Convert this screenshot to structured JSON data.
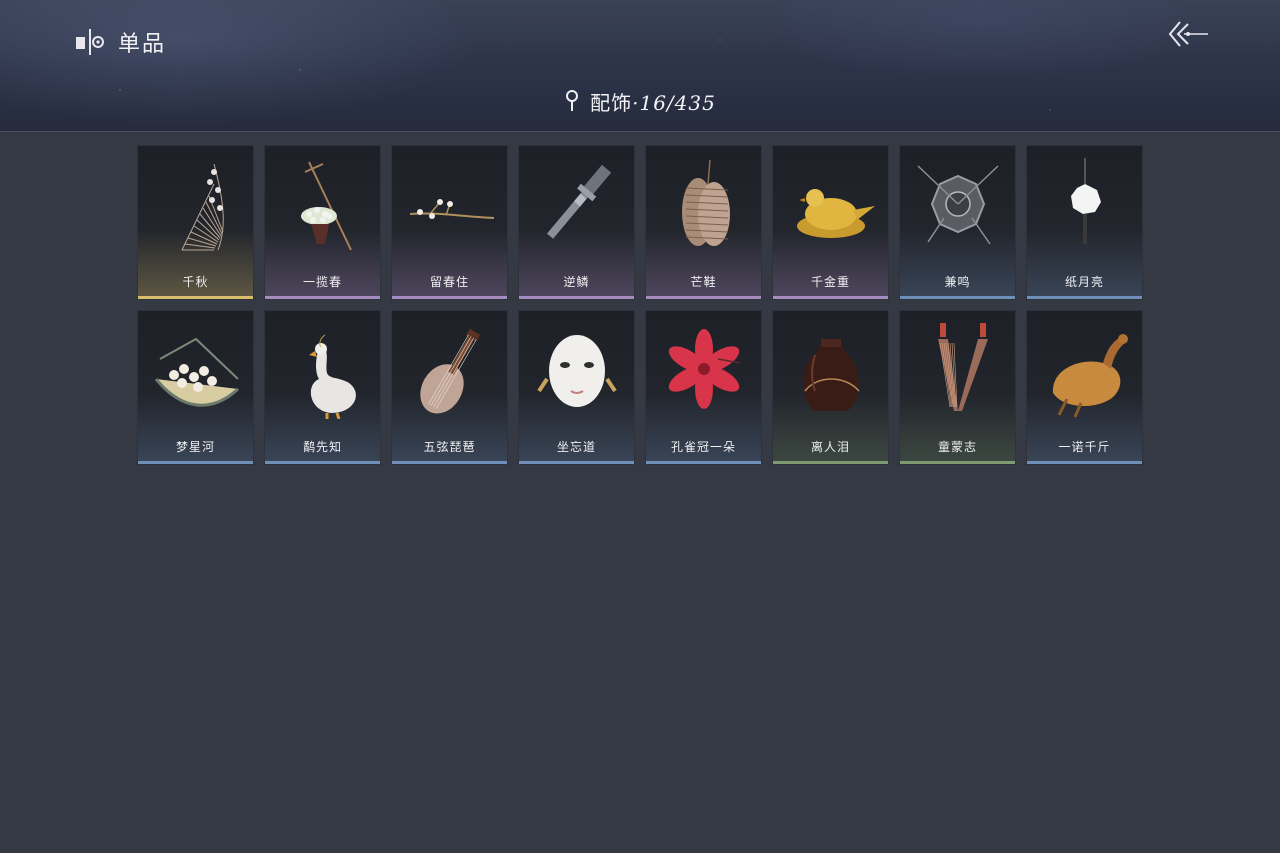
{
  "header": {
    "title": "单品",
    "category_name": "配饰",
    "category_separator": "·",
    "category_count": "16/435"
  },
  "items": [
    {
      "label": "千秋",
      "icon": "swing-flower-icon",
      "quality": "gold"
    },
    {
      "label": "一揽春",
      "icon": "flower-basket-icon",
      "quality": "purple"
    },
    {
      "label": "留春住",
      "icon": "blossom-branch-icon",
      "quality": "purple"
    },
    {
      "label": "逆鳞",
      "icon": "scabbard-icon",
      "quality": "purple"
    },
    {
      "label": "芒鞋",
      "icon": "straw-sandals-icon",
      "quality": "purple"
    },
    {
      "label": "千金重",
      "icon": "golden-bird-icon",
      "quality": "purple"
    },
    {
      "label": "兼鸣",
      "icon": "mirror-pendant-icon",
      "quality": "blue"
    },
    {
      "label": "纸月亮",
      "icon": "paper-moon-icon",
      "quality": "blue"
    },
    {
      "label": "梦星河",
      "icon": "flower-boat-icon",
      "quality": "blue"
    },
    {
      "label": "鹬先知",
      "icon": "duck-icon",
      "quality": "blue"
    },
    {
      "label": "五弦琵琶",
      "icon": "pipa-lute-icon",
      "quality": "blue"
    },
    {
      "label": "坐忘道",
      "icon": "white-mask-icon",
      "quality": "blue"
    },
    {
      "label": "孔雀冠一朵",
      "icon": "red-flower-icon",
      "quality": "blue"
    },
    {
      "label": "离人泪",
      "icon": "wine-jar-icon",
      "quality": "green"
    },
    {
      "label": "童蒙志",
      "icon": "tassel-pendants-icon",
      "quality": "green"
    },
    {
      "label": "一诺千斤",
      "icon": "roast-chicken-icon",
      "quality": "blue"
    }
  ],
  "colors": {
    "background": "#353944",
    "gold": "#d8be6a",
    "purple": "#a48cc0",
    "blue": "#6f8fb8",
    "green": "#7e9a70"
  }
}
